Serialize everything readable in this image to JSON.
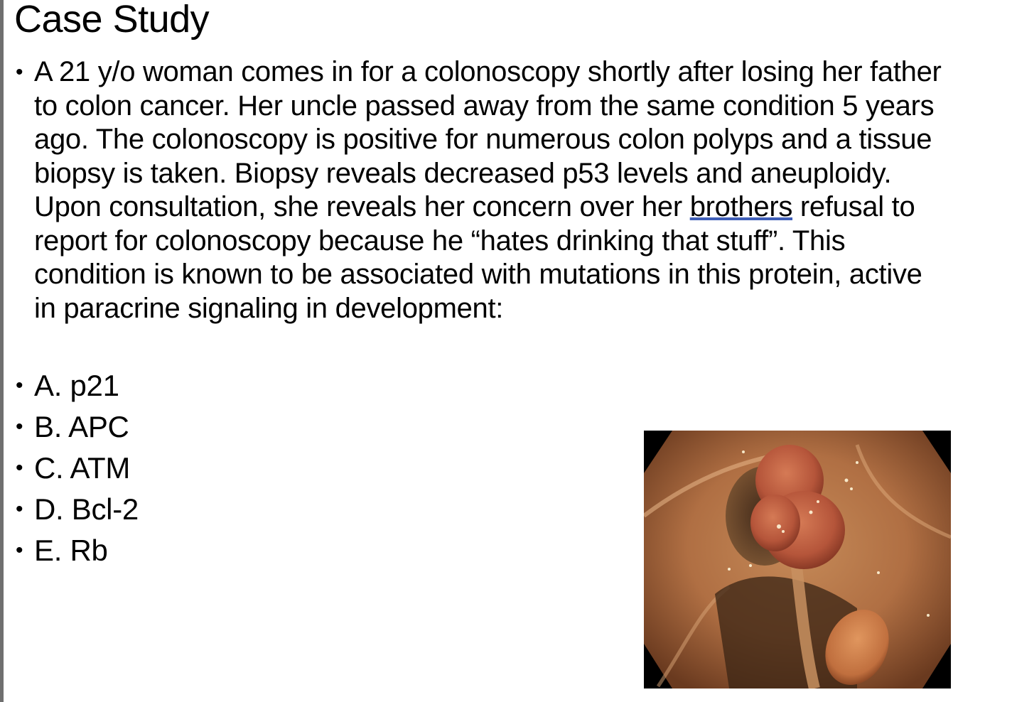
{
  "slide": {
    "title": "Case Study",
    "question": {
      "before_underline": "A 21 y/o woman comes in for a colonoscopy shortly after losing her father to colon cancer. Her uncle passed away from the same condition 5 years ago. The colonoscopy is positive for numerous colon polyps and a tissue biopsy is taken. Biopsy reveals decreased p53 levels and aneuploidy. Upon consultation, she reveals her concern over her ",
      "underlined": "brothers",
      "after_underline": " refusal to report for colonoscopy because he “hates drinking that stuff”. This condition is known to be associated with mutations in this protein, active in paracrine signaling in development:"
    },
    "options": [
      {
        "label": "A. p21"
      },
      {
        "label": "B. APC"
      },
      {
        "label": "C. ATM"
      },
      {
        "label": "D. Bcl-2"
      },
      {
        "label": "E. Rb"
      }
    ],
    "bullet_glyph": "•"
  }
}
